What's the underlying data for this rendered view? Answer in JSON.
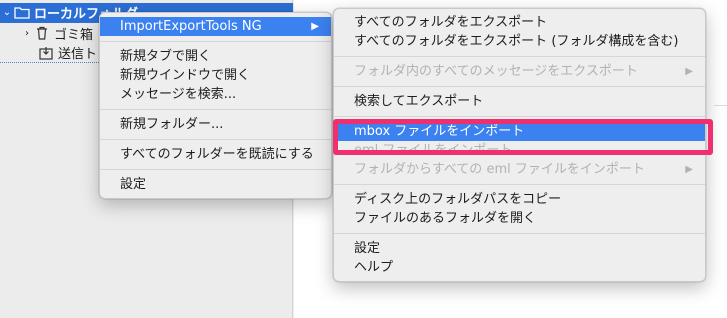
{
  "folder_pane": {
    "local_folders": "ローカルフォルダー",
    "trash": "ゴミ箱",
    "sent": "送信ト"
  },
  "context_menu": {
    "items": [
      "ImportExportTools NG",
      "新規タブで開く",
      "新規ウインドウで開く",
      "メッセージを検索...",
      "新規フォルダー...",
      "すべてのフォルダーを既読にする",
      "設定"
    ]
  },
  "submenu": {
    "items": [
      "すべてのフォルダをエクスポート",
      "すべてのフォルダをエクスポート (フォルダ構成を含む)",
      "フォルダ内のすべてのメッセージをエクスポート",
      "検索してエクスポート",
      "mbox ファイルをインポート",
      "eml ファイルをインポート",
      "フォルダからすべての eml ファイルをインポート",
      "ディスク上のフォルダパスをコピー",
      "ファイルのあるフォルダを開く",
      "設定",
      "ヘルプ"
    ]
  },
  "colors": {
    "highlight": "#3b82f0",
    "annotation": "#ef2f6e",
    "selected_row": "#2b6fd6"
  }
}
